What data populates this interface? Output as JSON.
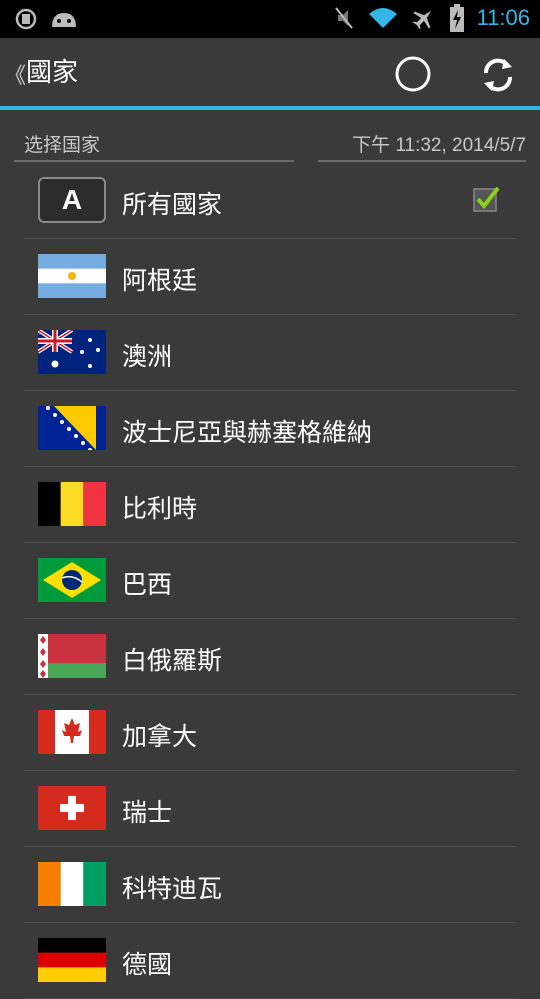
{
  "status_bar": {
    "time": "11:06"
  },
  "action_bar": {
    "back_glyph": "《",
    "title": "國家"
  },
  "header": {
    "left_label": "选择国家",
    "right_label": "下午 11:32, 2014/5/7"
  },
  "all_item": {
    "letter": "A",
    "label": "所有國家",
    "checked": true
  },
  "countries": [
    {
      "label": "阿根廷",
      "flag": "argentina"
    },
    {
      "label": "澳洲",
      "flag": "australia"
    },
    {
      "label": "波士尼亞與赫塞格維納",
      "flag": "bosnia"
    },
    {
      "label": "比利時",
      "flag": "belgium"
    },
    {
      "label": "巴西",
      "flag": "brazil"
    },
    {
      "label": "白俄羅斯",
      "flag": "belarus"
    },
    {
      "label": "加拿大",
      "flag": "canada"
    },
    {
      "label": "瑞士",
      "flag": "switzerland"
    },
    {
      "label": "科特迪瓦",
      "flag": "cote_divoire"
    },
    {
      "label": "德國",
      "flag": "germany"
    }
  ],
  "colors": {
    "accent": "#33b5e5",
    "background": "#3a3a3a",
    "check": "#8bd21f"
  }
}
